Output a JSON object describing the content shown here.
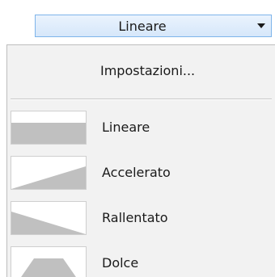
{
  "combo": {
    "selected": "Lineare"
  },
  "menu": {
    "header": "Impostazioni...",
    "items": [
      {
        "label": "Lineare",
        "icon": "linear-curve-icon"
      },
      {
        "label": "Accelerato",
        "icon": "accelerate-curve-icon"
      },
      {
        "label": "Rallentato",
        "icon": "decelerate-curve-icon"
      },
      {
        "label": "Dolce",
        "icon": "smooth-curve-icon"
      }
    ]
  },
  "colors": {
    "combo_border": "#7eb4ea",
    "combo_fill": "#d6e7fa",
    "menu_bg": "#f2f2f2",
    "icon_fill": "#c0c0c0"
  }
}
